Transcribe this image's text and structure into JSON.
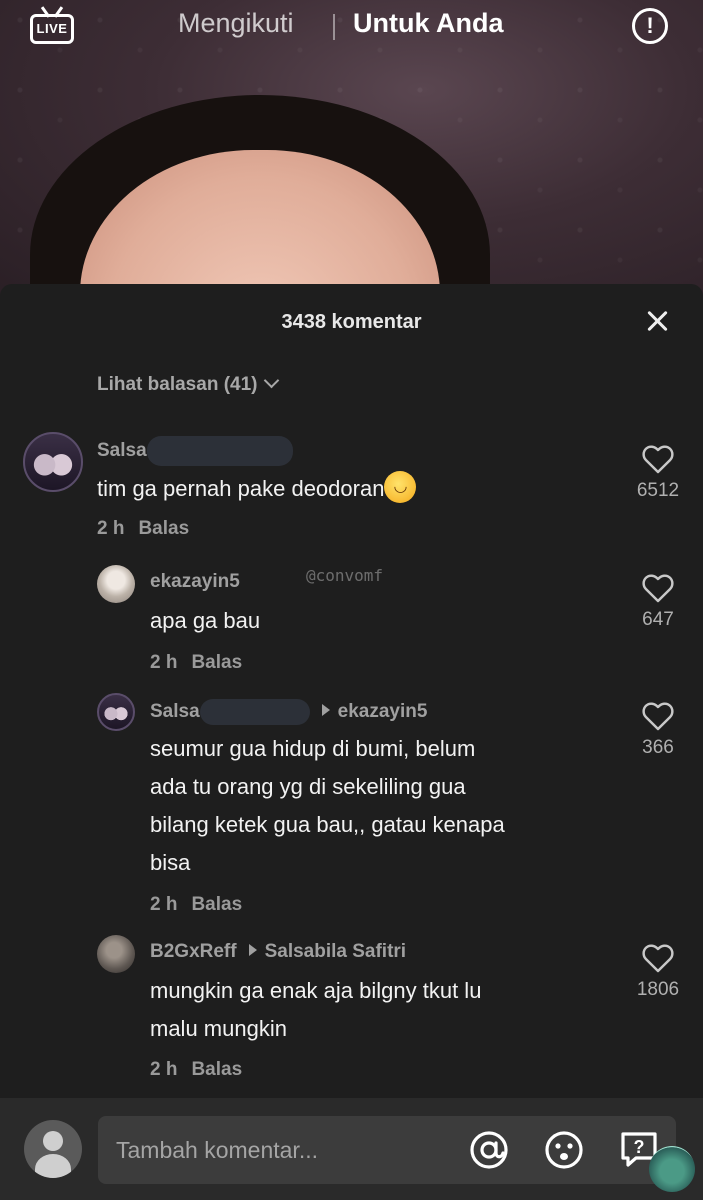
{
  "top_bar": {
    "live_label": "LIVE",
    "tabs": [
      {
        "label": "Mengikuti",
        "active": false
      },
      {
        "label": "Untuk Anda",
        "active": true
      }
    ],
    "report_icon": "exclamation-circle-icon"
  },
  "panel": {
    "title": "3438 komentar",
    "view_replies": "Lihat balasan (41)"
  },
  "watermark": "@convomf",
  "comments": [
    {
      "username": "Salsa",
      "text": "tim ga pernah pake deodoran",
      "emoji": "😅",
      "time": "2 h",
      "reply_label": "Balas",
      "likes": "6512"
    },
    {
      "username": "ekazayin5",
      "text": "apa ga bau",
      "time": "2 h",
      "reply_label": "Balas",
      "likes": "647"
    },
    {
      "username": "Salsa",
      "reply_to": "ekazayin5",
      "text_lines": [
        "seumur gua hidup di bumi, belum",
        "ada tu orang yg di sekeliling gua",
        "bilang ketek gua bau,, gatau kenapa",
        "bisa"
      ],
      "time": "2 h",
      "reply_label": "Balas",
      "likes": "366"
    },
    {
      "username": "B2GxReff",
      "reply_to": "Salsabila Safitri",
      "text_lines": [
        "mungkin ga enak aja bilgny tkut lu",
        "malu mungkin"
      ],
      "time": "2 h",
      "reply_label": "Balas",
      "likes": "1806"
    }
  ],
  "input": {
    "placeholder": "Tambah komentar..."
  },
  "colors": {
    "panel_bg": "#1e1e1e",
    "input_bg": "#3c3c3c",
    "muted_text": "#a0a0a0"
  }
}
